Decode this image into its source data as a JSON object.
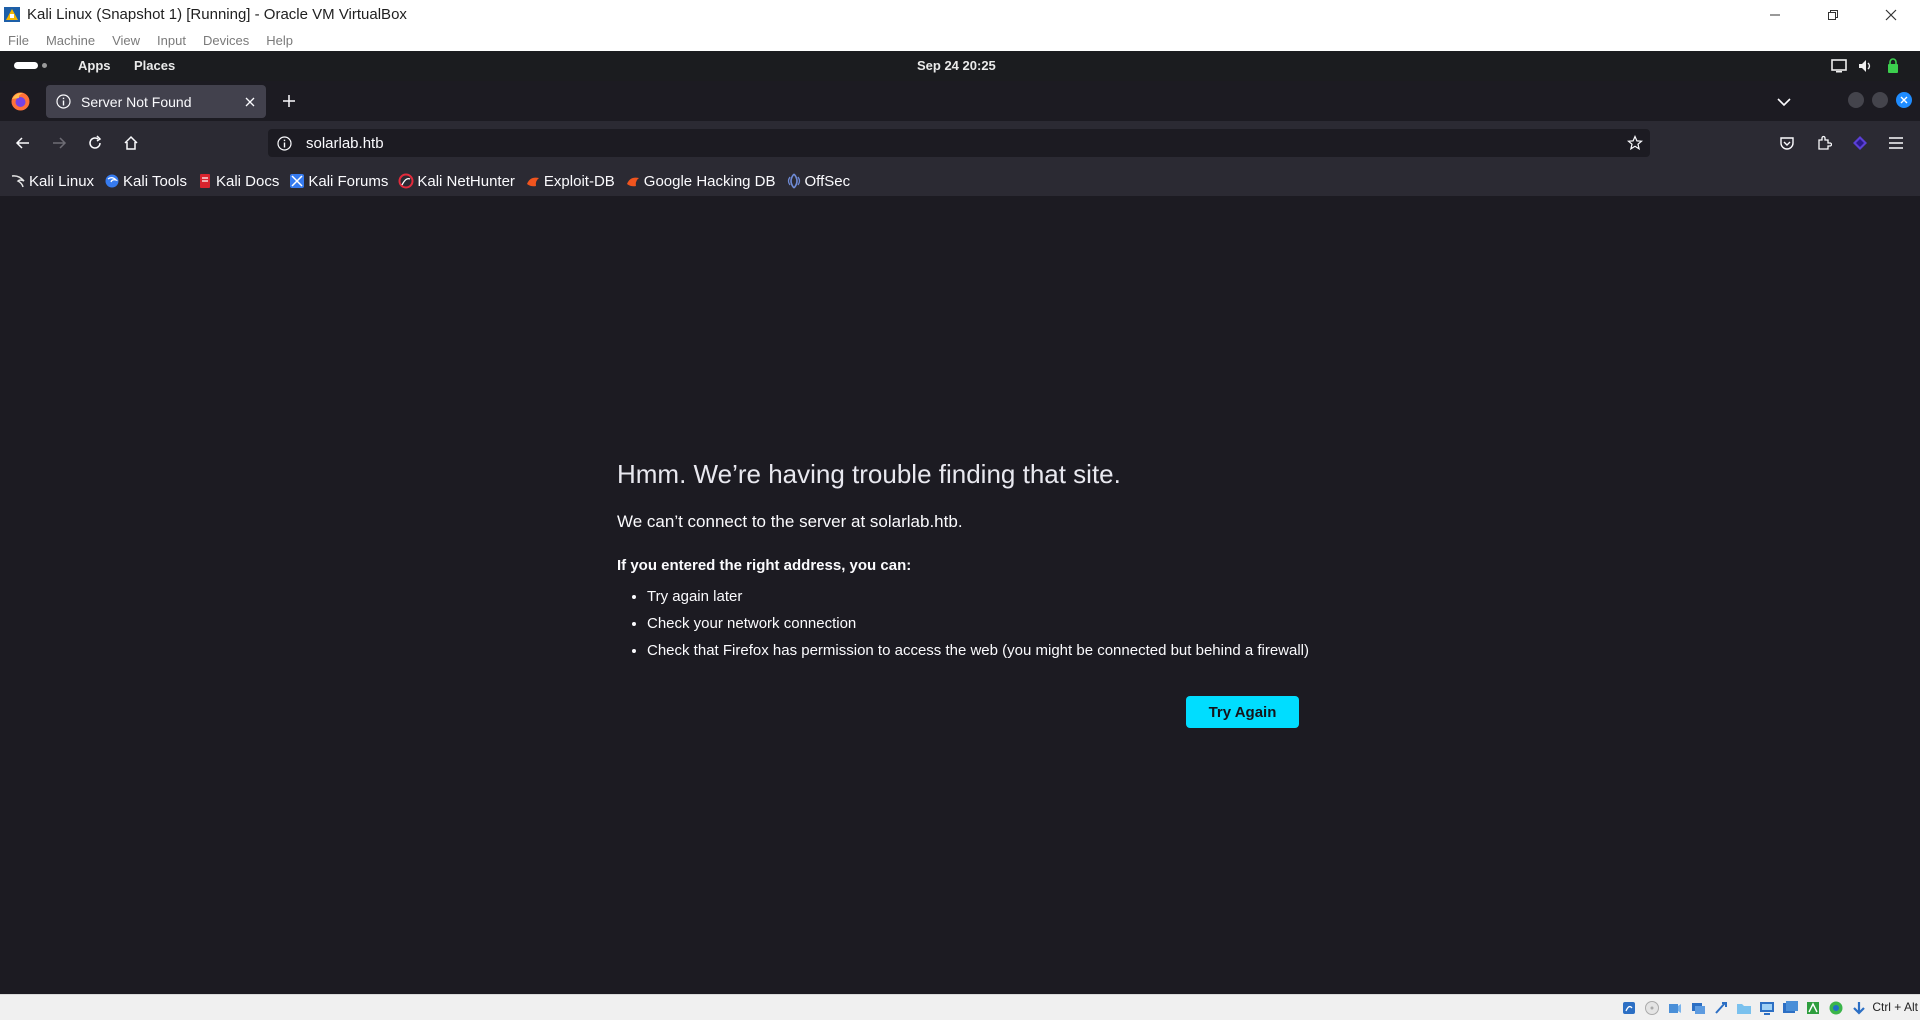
{
  "vbox": {
    "title": "Kali Linux (Snapshot 1) [Running] - Oracle VM VirtualBox",
    "menu": [
      "File",
      "Machine",
      "View",
      "Input",
      "Devices",
      "Help"
    ],
    "host_key": "Ctrl + Alt"
  },
  "kali_panel": {
    "apps": "Apps",
    "places": "Places",
    "clock": "Sep 24  20:25"
  },
  "browser": {
    "tab_title": "Server Not Found",
    "url": "solarlab.htb",
    "bookmarks": [
      {
        "label": "Kali Linux",
        "icon": "kali-dragon-icon"
      },
      {
        "label": "Kali Tools",
        "icon": "kali-tools-icon"
      },
      {
        "label": "Kali Docs",
        "icon": "kali-docs-icon"
      },
      {
        "label": "Kali Forums",
        "icon": "kali-forums-icon"
      },
      {
        "label": "Kali NetHunter",
        "icon": "nethunter-icon"
      },
      {
        "label": "Exploit-DB",
        "icon": "exploit-db-icon"
      },
      {
        "label": "Google Hacking DB",
        "icon": "ghdb-icon"
      },
      {
        "label": "OffSec",
        "icon": "offsec-icon"
      }
    ]
  },
  "error_page": {
    "title": "Hmm. We’re having trouble finding that site.",
    "description": "We can’t connect to the server at solarlab.htb.",
    "hint": "If you entered the right address, you can:",
    "suggestions": [
      "Try again later",
      "Check your network connection",
      "Check that Firefox has permission to access the web (you might be connected but behind a firewall)"
    ],
    "button": "Try Again"
  },
  "colors": {
    "accent": "#00ddff",
    "page_bg": "#1c1b22",
    "toolbar_bg": "#2b2a33"
  }
}
